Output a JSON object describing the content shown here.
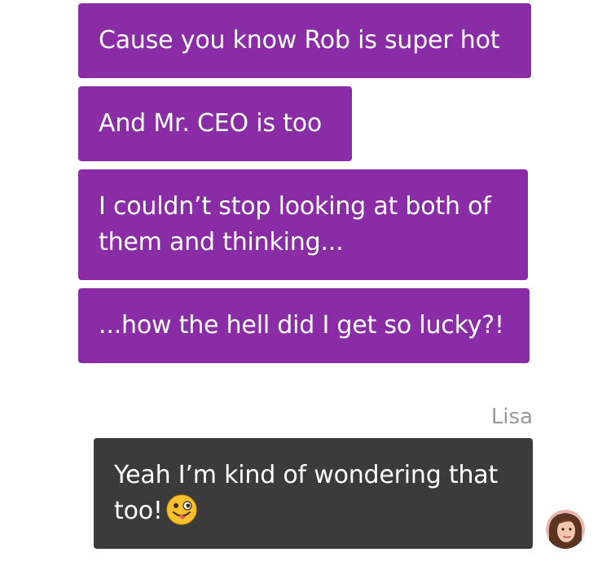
{
  "messages": [
    {
      "text": "Cause you know Rob is super hot"
    },
    {
      "text": "And Mr. CEO is too"
    },
    {
      "text": "I couldn’t stop looking at both of them and thinking..."
    },
    {
      "text": "...how the hell did I get so lucky?!"
    },
    {
      "sender": "Lisa",
      "text": "Yeah I’m kind of wondering that too!",
      "emoji": "winking-face-with-tongue-icon"
    }
  ],
  "colors": {
    "outgoing_bubble": "#8a2ca6",
    "incoming_bubble": "#3b3b3b",
    "sender_name": "#9a9a9a"
  }
}
